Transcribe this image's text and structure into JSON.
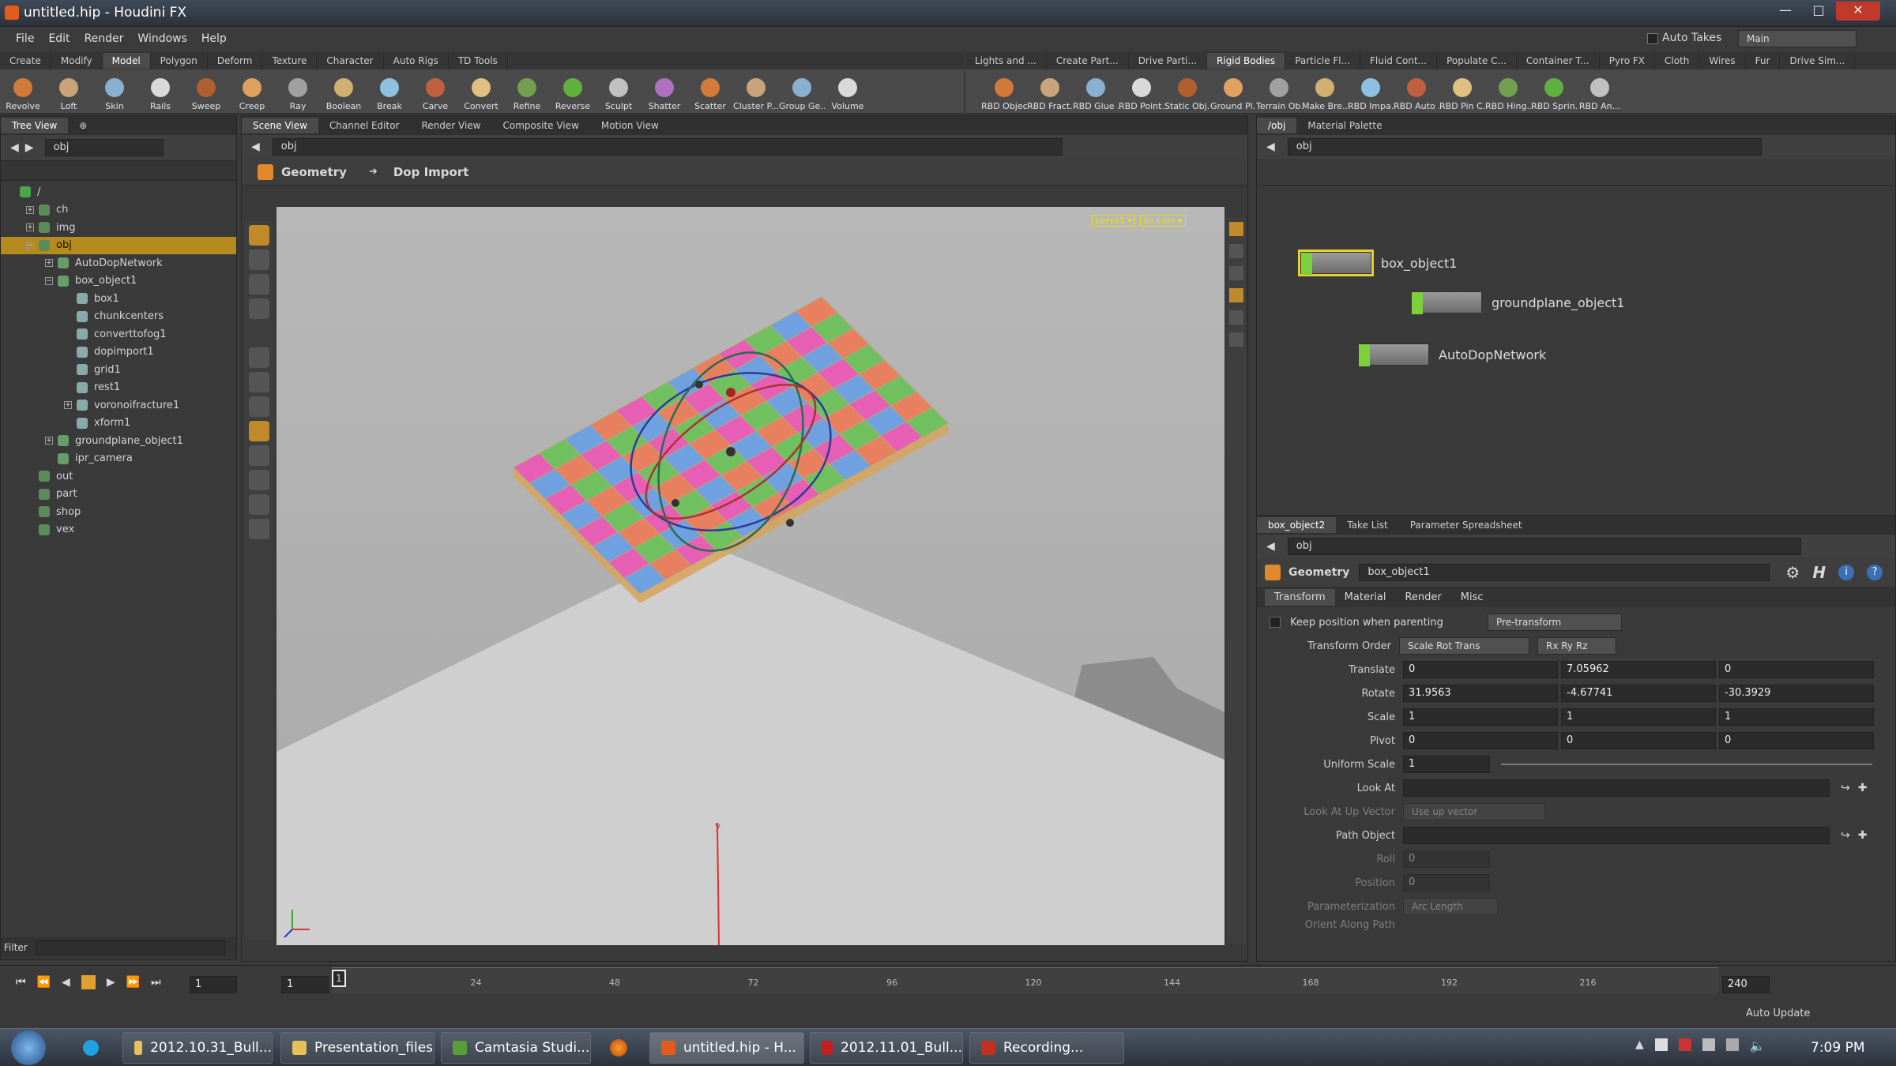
{
  "window": {
    "title": "untitled.hip - Houdini FX",
    "min": "—",
    "max": "□",
    "close": "✕"
  },
  "menu": [
    "File",
    "Edit",
    "Render",
    "Windows",
    "Help"
  ],
  "top_right": {
    "auto_takes": "Auto Takes",
    "desktop": "Main"
  },
  "shelf_left": {
    "tabs": [
      "Create",
      "Modify",
      "Model",
      "Polygon",
      "Deform",
      "Texture",
      "Character",
      "Auto Rigs",
      "TD Tools"
    ],
    "active": "Model",
    "tools": [
      "Revolve",
      "Loft",
      "Skin",
      "Rails",
      "Sweep",
      "Creep",
      "Ray",
      "Boolean",
      "Break",
      "Carve",
      "Convert",
      "Refine",
      "Reverse",
      "Sculpt",
      "Shatter",
      "Scatter",
      "Cluster P...",
      "Group Ge...",
      "Volume"
    ]
  },
  "shelf_right": {
    "tabs": [
      "Lights and ...",
      "Create Part...",
      "Drive Parti...",
      "Rigid Bodies",
      "Particle Fl...",
      "Fluid Cont...",
      "Populate C...",
      "Container T...",
      "Pyro FX",
      "Cloth",
      "Wires",
      "Fur",
      "Drive Sim..."
    ],
    "active": "Rigid Bodies",
    "tools": [
      "RBD Object",
      "RBD Fract...",
      "RBD Glue ...",
      "RBD Point...",
      "Static Obj...",
      "Ground Pl...",
      "Terrain Ob...",
      "Make Bre...",
      "RBD Impa...",
      "RBD Auto ...",
      "RBD Pin C...",
      "RBD Hing...",
      "RBD Sprin...",
      "RBD An..."
    ]
  },
  "tree": {
    "tab": "Tree View",
    "path": "obj",
    "nodes": [
      {
        "label": "/",
        "depth": 0
      },
      {
        "label": "ch",
        "depth": 1
      },
      {
        "label": "img",
        "depth": 1
      },
      {
        "label": "obj",
        "depth": 1,
        "selected": true
      },
      {
        "label": "AutoDopNetwork",
        "depth": 2
      },
      {
        "label": "box_object1",
        "depth": 2
      },
      {
        "label": "box1",
        "depth": 3
      },
      {
        "label": "chunkcenters",
        "depth": 3
      },
      {
        "label": "converttofog1",
        "depth": 3
      },
      {
        "label": "dopimport1",
        "depth": 3
      },
      {
        "label": "grid1",
        "depth": 3
      },
      {
        "label": "rest1",
        "depth": 3
      },
      {
        "label": "voronoifracture1",
        "depth": 3
      },
      {
        "label": "xform1",
        "depth": 3
      },
      {
        "label": "groundplane_object1",
        "depth": 2
      },
      {
        "label": "ipr_camera",
        "depth": 2
      },
      {
        "label": "out",
        "depth": 1
      },
      {
        "label": "part",
        "depth": 1
      },
      {
        "label": "shop",
        "depth": 1
      },
      {
        "label": "vex",
        "depth": 1
      }
    ],
    "filter_label": "Filter"
  },
  "viewer": {
    "tabs": [
      "Scene View",
      "Channel Editor",
      "Render View",
      "Composite View",
      "Motion View"
    ],
    "active": "Scene View",
    "path": "obj",
    "context": "Geometry",
    "state": "Dop Import",
    "cam_menu": "persp1 ▾",
    "nocam_menu": "no cam ▾"
  },
  "network": {
    "tabs": [
      "/obj",
      "Material Palette"
    ],
    "path": "obj",
    "nodes": [
      "box_object1",
      "groundplane_object1",
      "AutoDopNetwork"
    ]
  },
  "params": {
    "tabs": [
      "box_object2",
      "Take List",
      "Parameter Spreadsheet"
    ],
    "path": "obj",
    "type": "Geometry",
    "name": "box_object1",
    "subtabs": [
      "Transform",
      "Material",
      "Render",
      "Misc"
    ],
    "keep_pos": "Keep position when parenting",
    "pretransform": "Pre-transform",
    "order_label": "Transform Order",
    "order1": "Scale Rot Trans",
    "order2": "Rx Ry Rz",
    "translate_label": "Translate",
    "translate": [
      "0",
      "7.05962",
      "0"
    ],
    "rotate_label": "Rotate",
    "rotate": [
      "31.9563",
      "-4.67741",
      "-30.3929"
    ],
    "scale_label": "Scale",
    "scale": [
      "1",
      "1",
      "1"
    ],
    "pivot_label": "Pivot",
    "pivot": [
      "0",
      "0",
      "0"
    ],
    "uniform_label": "Uniform Scale",
    "uniform": "1",
    "lookat_label": "Look At",
    "upvec_label": "Look At Up Vector",
    "upvec": "Use up vector",
    "pathobj_label": "Path Object",
    "roll_label": "Roll",
    "roll": "0",
    "position_label": "Position",
    "position": "0",
    "param_label": "Parameterization",
    "param_val": "Arc Length",
    "orient_label": "Orient Along Path"
  },
  "timeline": {
    "frame": "1",
    "start": "1",
    "end": "240",
    "ticks": [
      "1",
      "24",
      "48",
      "72",
      "96",
      "120",
      "144",
      "168",
      "192",
      "216"
    ],
    "auto_update": "Auto Update"
  },
  "taskbar": {
    "items": [
      "2012.10.31_Bull...",
      "Presentation_files",
      "Camtasia Studi...",
      "",
      "untitled.hip - H...",
      "2012.11.01_Bull...",
      "Recording..."
    ],
    "active": 4,
    "clock": "7:09 PM"
  }
}
